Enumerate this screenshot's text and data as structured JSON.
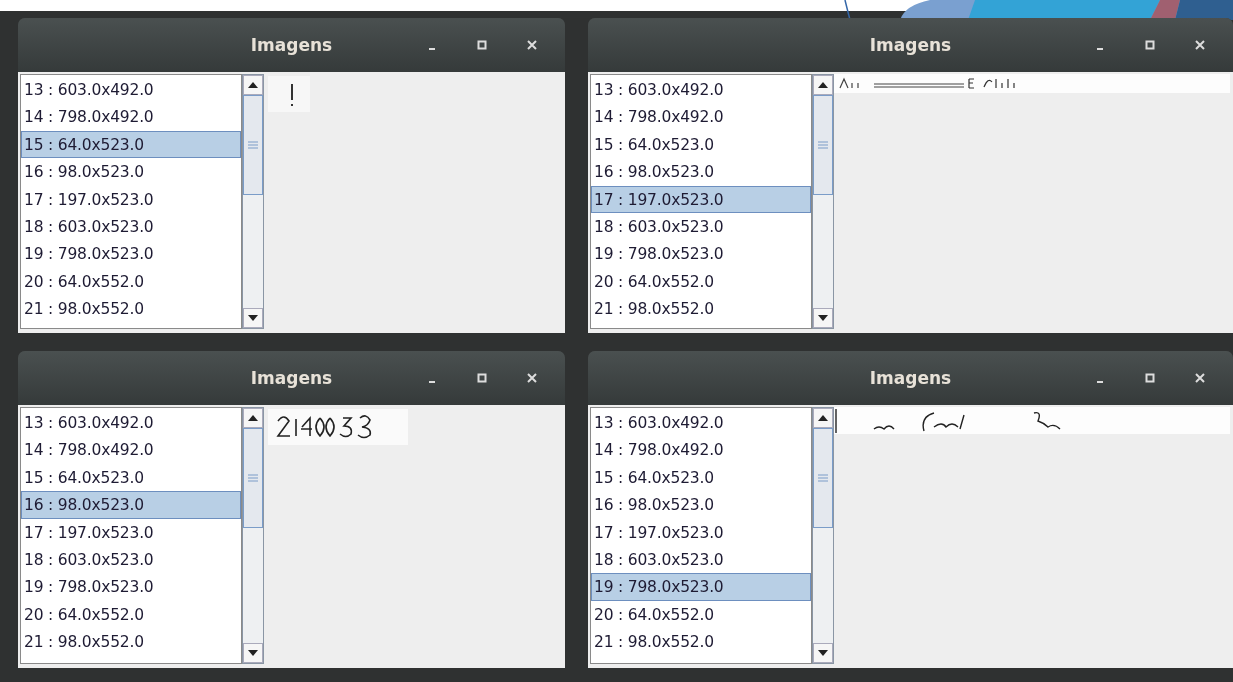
{
  "windows": [
    {
      "title": "Imagens",
      "kind": "small-mark",
      "items": [
        {
          "label": "13 : 603.0x492.0",
          "selected": false
        },
        {
          "label": "14 : 798.0x492.0",
          "selected": false
        },
        {
          "label": "15 : 64.0x523.0",
          "selected": true
        },
        {
          "label": "16 : 98.0x523.0",
          "selected": false
        },
        {
          "label": "17 : 197.0x523.0",
          "selected": false
        },
        {
          "label": "18 : 603.0x523.0",
          "selected": false
        },
        {
          "label": "19 : 798.0x523.0",
          "selected": false
        },
        {
          "label": "20 : 64.0x552.0",
          "selected": false
        },
        {
          "label": "21 : 98.0x552.0",
          "selected": false
        }
      ]
    },
    {
      "title": "Imagens",
      "kind": "wide-strip",
      "items": [
        {
          "label": "13 : 603.0x492.0",
          "selected": false
        },
        {
          "label": "14 : 798.0x492.0",
          "selected": false
        },
        {
          "label": "15 : 64.0x523.0",
          "selected": false
        },
        {
          "label": "16 : 98.0x523.0",
          "selected": false
        },
        {
          "label": "17 : 197.0x523.0",
          "selected": true
        },
        {
          "label": "18 : 603.0x523.0",
          "selected": false
        },
        {
          "label": "19 : 798.0x523.0",
          "selected": false
        },
        {
          "label": "20 : 64.0x552.0",
          "selected": false
        },
        {
          "label": "21 : 98.0x552.0",
          "selected": false
        }
      ]
    },
    {
      "title": "Imagens",
      "kind": "number-block",
      "items": [
        {
          "label": "13 : 603.0x492.0",
          "selected": false
        },
        {
          "label": "14 : 798.0x492.0",
          "selected": false
        },
        {
          "label": "15 : 64.0x523.0",
          "selected": false
        },
        {
          "label": "16 : 98.0x523.0",
          "selected": true
        },
        {
          "label": "17 : 197.0x523.0",
          "selected": false
        },
        {
          "label": "18 : 603.0x523.0",
          "selected": false
        },
        {
          "label": "19 : 798.0x523.0",
          "selected": false
        },
        {
          "label": "20 : 64.0x552.0",
          "selected": false
        },
        {
          "label": "21 : 98.0x552.0",
          "selected": false
        }
      ]
    },
    {
      "title": "Imagens",
      "kind": "handwriting-strip",
      "items": [
        {
          "label": "13 : 603.0x492.0",
          "selected": false
        },
        {
          "label": "14 : 798.0x492.0",
          "selected": false
        },
        {
          "label": "15 : 64.0x523.0",
          "selected": false
        },
        {
          "label": "16 : 98.0x523.0",
          "selected": false
        },
        {
          "label": "17 : 197.0x523.0",
          "selected": false
        },
        {
          "label": "18 : 603.0x523.0",
          "selected": false
        },
        {
          "label": "19 : 798.0x523.0",
          "selected": true
        },
        {
          "label": "20 : 64.0x552.0",
          "selected": false
        },
        {
          "label": "21 : 98.0x552.0",
          "selected": false
        }
      ]
    }
  ]
}
